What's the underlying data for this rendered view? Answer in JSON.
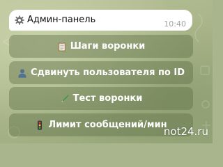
{
  "message": {
    "icon": "gear-icon",
    "text": "Админ-панель",
    "time": "10:40"
  },
  "keyboard": {
    "buttons": [
      {
        "icon": "clipboard-icon",
        "label": "Шаги воронки"
      },
      {
        "icon": "bust-in-silhouette-icon",
        "label": "Сдвинуть пользователя по ID"
      },
      {
        "icon": "pen-icon",
        "label": "Тест воронки"
      },
      {
        "icon": "traffic-light-icon",
        "label": "Лимит сообщений/мин"
      }
    ]
  },
  "watermark": "not24.ru",
  "colors": {
    "bubble_bg": "#ffffff",
    "button_bg": "#6a7d52",
    "time_text": "#a3a3a3"
  }
}
